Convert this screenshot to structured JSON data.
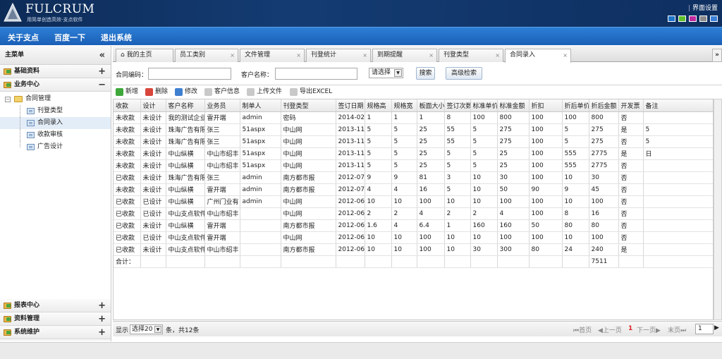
{
  "header": {
    "logo_title": "FULCRUM",
    "logo_sub": "用简单创造高效-支点软件",
    "setting_label": "界面设置",
    "theme_swatches": [
      "#1e74c9",
      "#5fbf2a",
      "#c02a9e",
      "#8a8a8a",
      "#3a7fd8"
    ]
  },
  "nav": {
    "items": [
      "关于支点",
      "百度一下",
      "退出系统"
    ]
  },
  "sidebar": {
    "title": "主菜单",
    "collapse_icon": "double-chevron-left-icon",
    "sections": {
      "base": "基础资料",
      "business": "业务中心",
      "report": "报表中心",
      "material": "资料管理",
      "system": "系统维护"
    },
    "tree": {
      "root": "合同管理",
      "items": [
        "刊登类型",
        "合同录入",
        "收款审核",
        "广告设计"
      ]
    }
  },
  "tabs": [
    "我的主页",
    "员工类别",
    "文件管理",
    "刊登统计",
    "到期提醒",
    "刊登类型",
    "合同录入"
  ],
  "search": {
    "contract_no_label": "合同编码：",
    "customer_label": "客户名称：",
    "select_value": "请选择",
    "search_btn": "搜索",
    "advanced_btn": "高级检索"
  },
  "toolbar": {
    "new": "新增",
    "delete": "删除",
    "edit": "修改",
    "customer": "客户信息",
    "upload": "上传文件",
    "export": "导出EXCEL"
  },
  "table": {
    "columns": [
      "收款",
      "设计",
      "客户名称",
      "业务员",
      "制单人",
      "刊登类型",
      "签订日期",
      "规格高",
      "规格宽",
      "板面大小",
      "签订次数",
      "标准单价",
      "标准金额",
      "折扣",
      "折后单价",
      "折后金额",
      "开发票",
      "备注"
    ],
    "rows": [
      [
        "未收款",
        "未设计",
        "我的测试企业",
        "雷开端",
        "admin",
        "密码",
        "2014-02-",
        "1",
        "1",
        "1",
        "8",
        "100",
        "800",
        "100",
        "100",
        "800",
        "否",
        ""
      ],
      [
        "未收款",
        "未设计",
        "珠海广告有限",
        "张三",
        "51aspx",
        "中山网",
        "2013-11-",
        "5",
        "5",
        "25",
        "55",
        "5",
        "275",
        "100",
        "5",
        "275",
        "是",
        "5"
      ],
      [
        "未收款",
        "未设计",
        "珠海广告有限",
        "张三",
        "51aspx",
        "中山网",
        "2013-11-",
        "5",
        "5",
        "25",
        "55",
        "5",
        "275",
        "100",
        "5",
        "275",
        "否",
        "5"
      ],
      [
        "未收款",
        "未设计",
        "中山纵横",
        "中山市绍丰",
        "51aspx",
        "中山网",
        "2013-11-",
        "5",
        "5",
        "25",
        "5",
        "5",
        "25",
        "100",
        "555",
        "2775",
        "是",
        "日"
      ],
      [
        "未收款",
        "未设计",
        "中山纵横",
        "中山市绍丰",
        "51aspx",
        "中山网",
        "2013-11-",
        "5",
        "5",
        "25",
        "5",
        "5",
        "25",
        "100",
        "555",
        "2775",
        "否",
        ""
      ],
      [
        "已收款",
        "未设计",
        "珠海广告有限",
        "张三",
        "admin",
        "南方都市报",
        "2012-07-",
        "9",
        "9",
        "81",
        "3",
        "10",
        "30",
        "100",
        "10",
        "30",
        "否",
        ""
      ],
      [
        "未收款",
        "未设计",
        "中山纵横",
        "雷开端",
        "admin",
        "南方都市报",
        "2012-07-",
        "4",
        "4",
        "16",
        "5",
        "10",
        "50",
        "90",
        "9",
        "45",
        "否",
        ""
      ],
      [
        "已收款",
        "已设计",
        "中山纵横",
        "广州门业有",
        "admin",
        "中山网",
        "2012-06-",
        "10",
        "10",
        "100",
        "10",
        "10",
        "100",
        "100",
        "10",
        "100",
        "否",
        ""
      ],
      [
        "已收款",
        "已设计",
        "中山支点软件",
        "中山市绍丰",
        "",
        "中山网",
        "2012-06-",
        "2",
        "2",
        "4",
        "2",
        "2",
        "4",
        "100",
        "8",
        "16",
        "否",
        ""
      ],
      [
        "已收款",
        "未设计",
        "中山纵横",
        "雷开端",
        "",
        "南方都市报",
        "2012-06-",
        "1.6",
        "4",
        "6.4",
        "1",
        "160",
        "160",
        "50",
        "80",
        "80",
        "否",
        ""
      ],
      [
        "已收款",
        "已设计",
        "中山支点软件",
        "雷开端",
        "",
        "中山网",
        "2012-06-",
        "10",
        "10",
        "100",
        "10",
        "10",
        "100",
        "100",
        "10",
        "100",
        "否",
        ""
      ],
      [
        "已收款",
        "未设计",
        "中山支点软件",
        "中山市绍丰",
        "",
        "南方都市报",
        "2012-06-",
        "10",
        "10",
        "100",
        "10",
        "30",
        "300",
        "80",
        "24",
        "240",
        "是",
        ""
      ]
    ],
    "total_label": "合计：",
    "total_value": "7511"
  },
  "pager": {
    "show_label": "显示",
    "page_size": "选择20",
    "summary": "条，共12条",
    "first": "首页",
    "prev": "上一页",
    "current": "1",
    "next": "下一页",
    "last": "末页",
    "page_input": "1"
  }
}
